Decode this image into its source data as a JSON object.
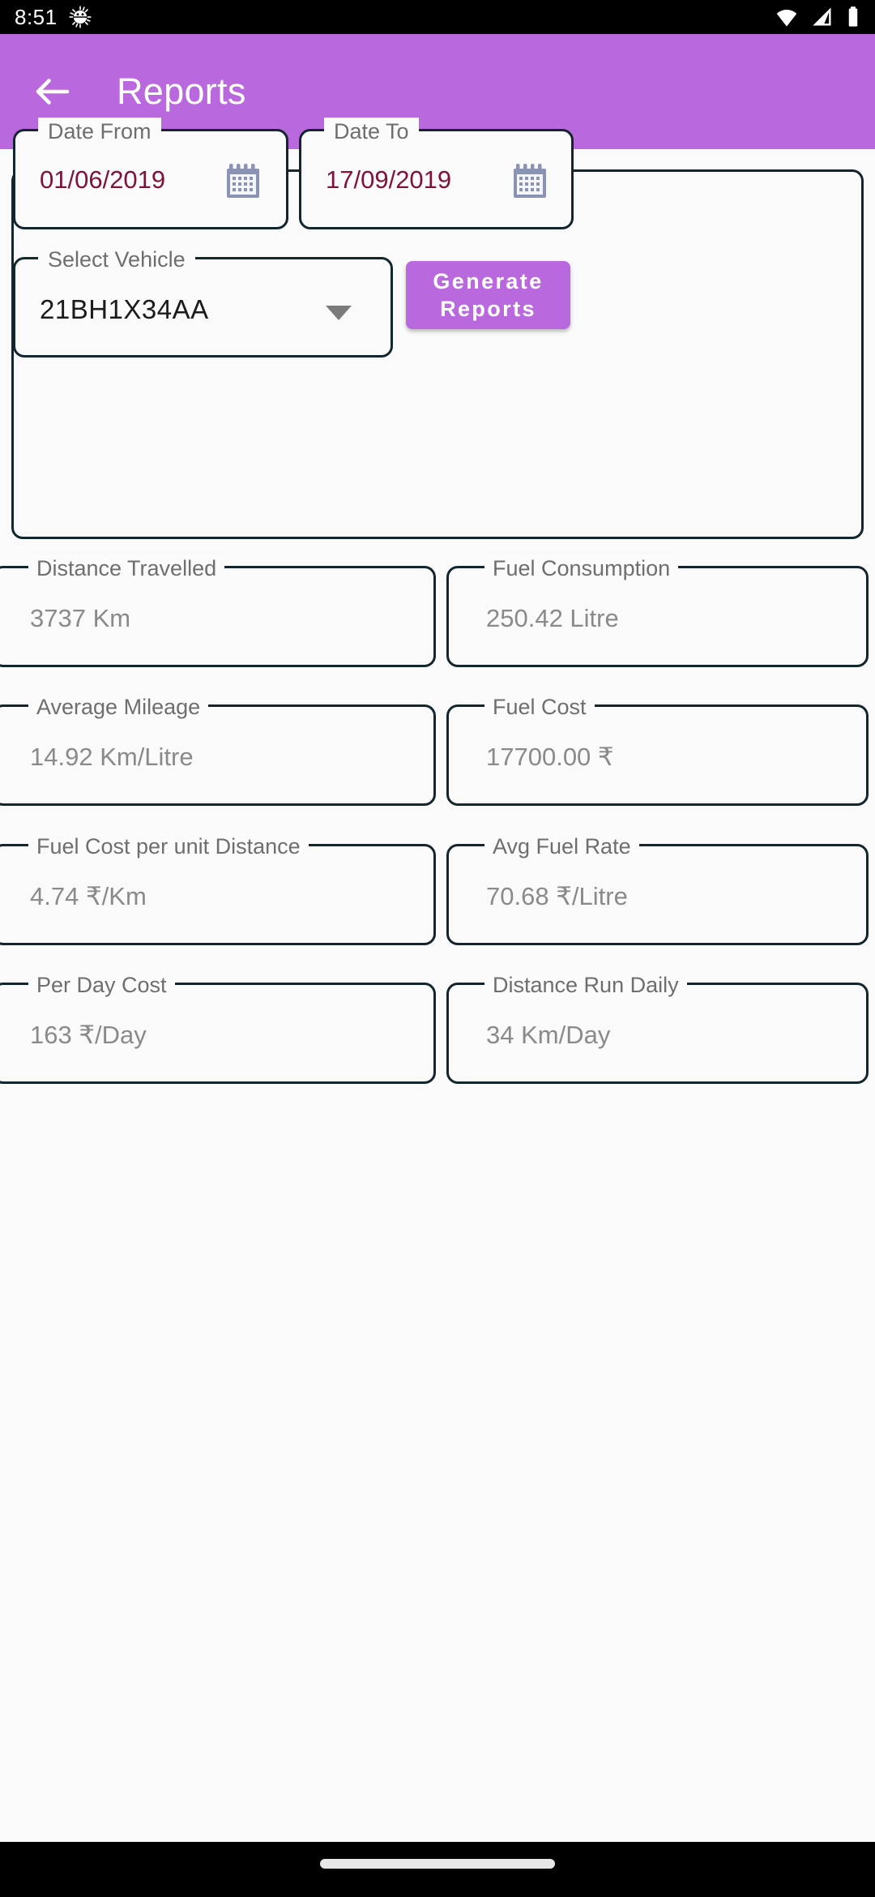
{
  "status_bar": {
    "time": "8:51",
    "icons": [
      "android-bug-icon",
      "wifi-icon",
      "cellular-signal-icon",
      "battery-icon"
    ]
  },
  "app_bar": {
    "title": "Reports",
    "back_icon": "arrow-back-icon",
    "background_color": "#ba68de"
  },
  "filters": {
    "date_from": {
      "label": "Date From",
      "value": "01/06/2019",
      "icon": "calendar-icon"
    },
    "date_to": {
      "label": "Date To",
      "value": "17/09/2019",
      "icon": "calendar-icon"
    },
    "select_vehicle": {
      "label": "Select Vehicle",
      "value": "21BH1X34AA",
      "icon": "chevron-down-icon"
    },
    "generate_button": {
      "line1": "Generate",
      "line2": "Reports"
    }
  },
  "results": [
    {
      "label": "Distance Travelled",
      "value": "3737 Km"
    },
    {
      "label": "Fuel Consumption",
      "value": "250.42 Litre"
    },
    {
      "label": "Average Mileage",
      "value": "14.92 Km/Litre"
    },
    {
      "label": "Fuel Cost",
      "value": "17700.00 ₹"
    },
    {
      "label": "Fuel Cost per unit Distance",
      "value": "4.74 ₹/Km"
    },
    {
      "label": "Avg Fuel Rate",
      "value": "70.68 ₹/Litre"
    },
    {
      "label": "Per Day Cost",
      "value": "163 ₹/Day"
    },
    {
      "label": "Distance Run Daily",
      "value": "34 Km/Day"
    }
  ],
  "nav_bar": {
    "handle": "gesture-home-handle"
  },
  "colors": {
    "accent": "#ba68de",
    "outline": "#14262d",
    "date_text": "#7e123c",
    "value_text": "#8a8a8a",
    "label_text": "#6e6e6e",
    "background": "#fafafa"
  }
}
